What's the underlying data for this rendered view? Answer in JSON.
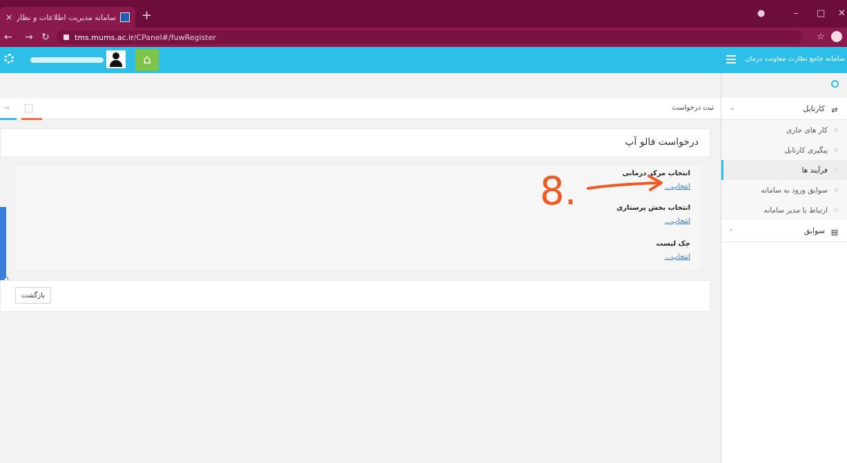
{
  "browser": {
    "tab_title": "سامانه مدیریت اطلاعات و نظارت ...",
    "tab_close": "×",
    "new_tab": "+",
    "url_host": "tms.mums.ac.ir",
    "url_path": "/CPanel#/fuwRegister"
  },
  "header": {
    "system_name": "سامانه جامع نظارت معاونت درمان",
    "home_glyph": "⌂"
  },
  "sidebar": {
    "kartabl_label": "کارتابل",
    "sub_items": [
      {
        "label": "کار های جاری"
      },
      {
        "label": "پیگیری کارتابل"
      },
      {
        "label": "فرآیند ها"
      },
      {
        "label": "سوابق ورود به سامانه"
      },
      {
        "label": "ارتباط با مدیر سامانه"
      }
    ],
    "savabegh_label": "سوابق"
  },
  "content": {
    "breadcrumb": "ثبت درخواست",
    "page_title": "درخواست فالو آپ",
    "fields": [
      {
        "label": "انتخاب مرکز درمانی",
        "link": "انتخاب..."
      },
      {
        "label": "انتخاب بخش پرستاری",
        "link": "انتخاب..."
      },
      {
        "label": "چک لیست",
        "link": "انتخاب..."
      }
    ],
    "back_button": "بازگشت"
  },
  "annotation": {
    "text": "8.",
    "color": "#f05a22"
  },
  "colors": {
    "header": "#2ebfe8",
    "browser": "#6d0d3a",
    "home": "#7ec34a"
  }
}
